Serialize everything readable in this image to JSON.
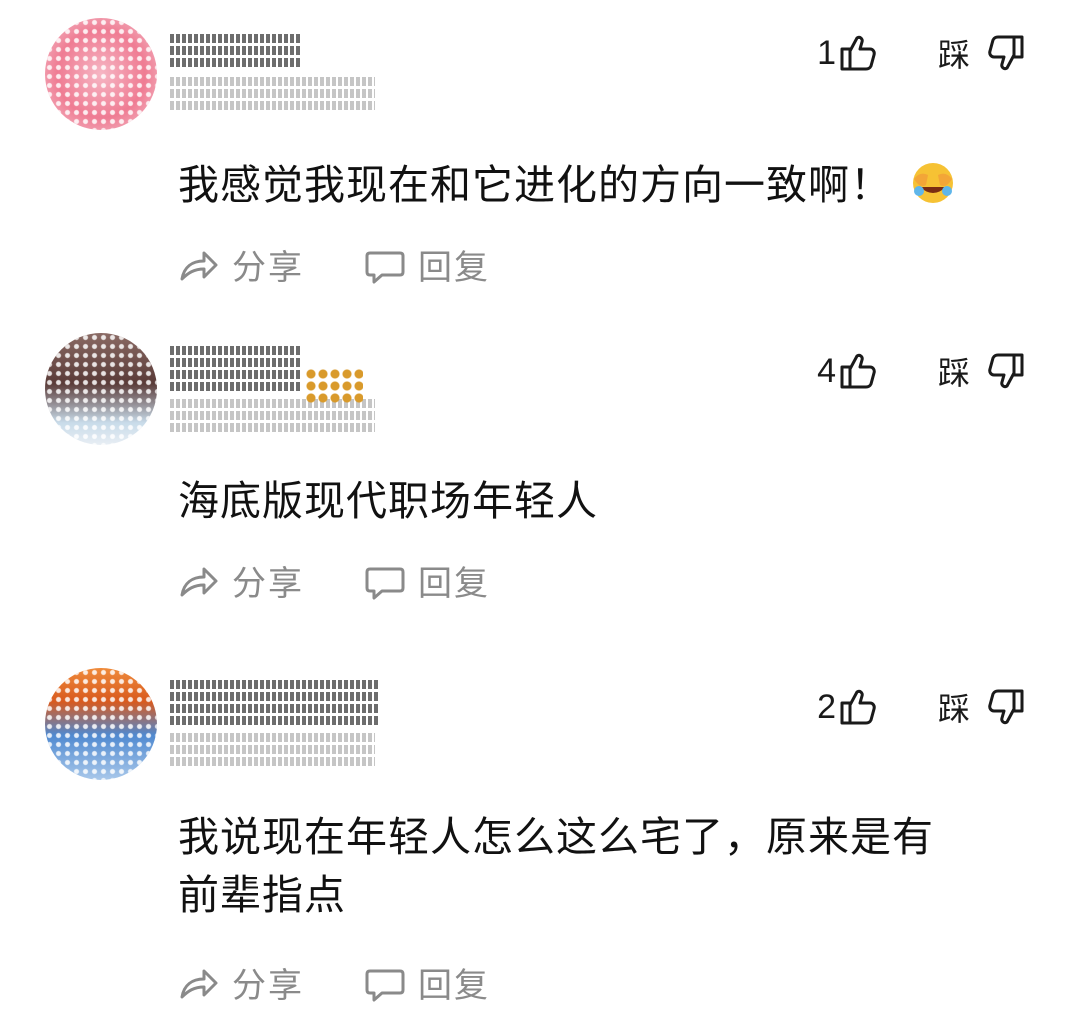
{
  "comments": [
    {
      "likes": "1",
      "dislike_label": "踩",
      "text": "我感觉我现在和它进化的方向一致啊！",
      "emoji": "laugh-cry-emoji",
      "share_label": "分享",
      "reply_label": "回复",
      "avatar_colors": [
        "#f3a3b5",
        "#e4506c"
      ]
    },
    {
      "likes": "4",
      "dislike_label": "踩",
      "text": "海底版现代职场年轻人",
      "share_label": "分享",
      "reply_label": "回复",
      "avatar_colors": [
        "#7a5a56",
        "#c9d8e6"
      ]
    },
    {
      "likes": "2",
      "dislike_label": "踩",
      "text_line1": "我说现在年轻人怎么这么宅了，原来是有",
      "text_line2": "前辈指点",
      "share_label": "分享",
      "reply_label": "回复",
      "avatar_colors": [
        "#e8752d",
        "#5b93d6"
      ]
    }
  ],
  "colors": {
    "text_primary": "#111111",
    "text_secondary": "#8a8a8a",
    "background": "#ffffff"
  }
}
